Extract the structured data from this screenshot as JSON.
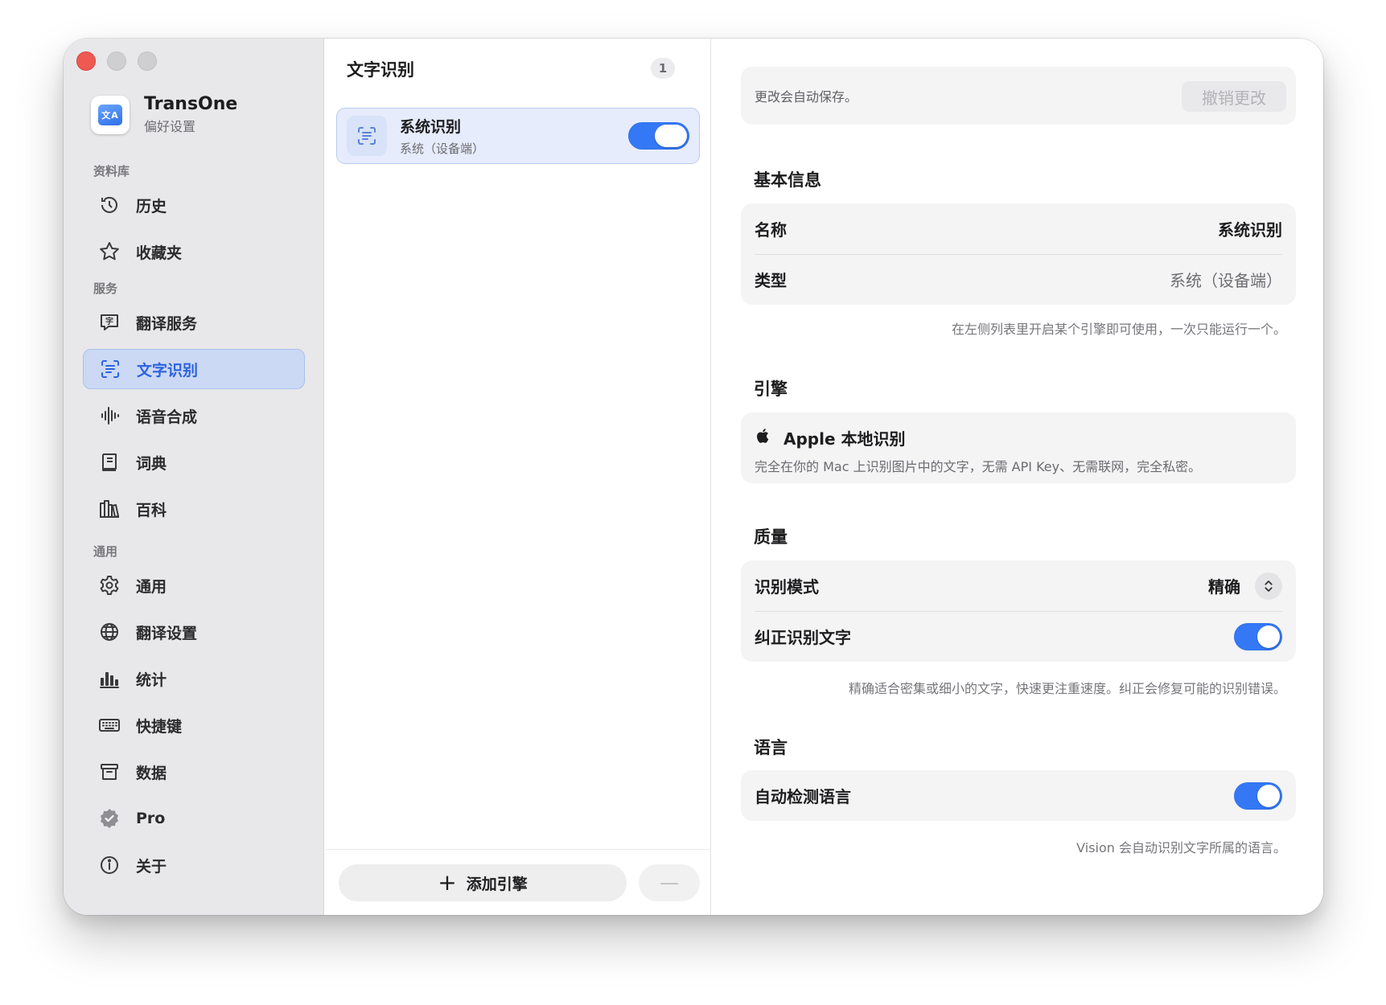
{
  "app": {
    "name": "TransOne",
    "subtitle": "偏好设置",
    "icon": "translate-app-icon"
  },
  "sidebar": {
    "sections": [
      {
        "label": "资料库"
      },
      {
        "label": "服务"
      },
      {
        "label": "通用"
      }
    ],
    "items": [
      {
        "label": "历史",
        "icon": "clock-icon"
      },
      {
        "label": "收藏夹",
        "icon": "star-icon"
      },
      {
        "label": "翻译服务",
        "icon": "translate-bubble-icon"
      },
      {
        "label": "文字识别",
        "icon": "text-scan-icon",
        "active": true
      },
      {
        "label": "语音合成",
        "icon": "waveform-icon"
      },
      {
        "label": "词典",
        "icon": "book-icon"
      },
      {
        "label": "百科",
        "icon": "books-icon"
      },
      {
        "label": "通用",
        "icon": "gear-icon"
      },
      {
        "label": "翻译设置",
        "icon": "globe-icon"
      },
      {
        "label": "统计",
        "icon": "bar-chart-icon"
      },
      {
        "label": "快捷键",
        "icon": "keyboard-icon"
      },
      {
        "label": "数据",
        "icon": "archive-box-icon"
      },
      {
        "label": "Pro",
        "icon": "verified-badge-icon"
      },
      {
        "label": "关于",
        "icon": "info-icon"
      }
    ]
  },
  "list": {
    "title": "文字识别",
    "count": "1",
    "engines": [
      {
        "name": "系统识别",
        "subtitle": "系统（设备端）",
        "enabled": true
      }
    ],
    "add_label": "添加引擎",
    "remove_label": "—"
  },
  "detail": {
    "banner": {
      "text": "更改会自动保存。",
      "revert_label": "撤销更改"
    },
    "basic": {
      "title": "基本信息",
      "name_label": "名称",
      "name_value": "系统识别",
      "type_label": "类型",
      "type_value": "系统（设备端）",
      "note": "在左侧列表里开启某个引擎即可使用，一次只能运行一个。"
    },
    "engine": {
      "title": "引擎",
      "name": "Apple 本地识别",
      "desc": "完全在你的 Mac 上识别图片中的文字，无需 API Key、无需联网，完全私密。"
    },
    "quality": {
      "title": "质量",
      "mode_label": "识别模式",
      "mode_value": "精确",
      "correct_label": "纠正识别文字",
      "correct_enabled": true,
      "note": "精确适合密集或细小的文字，快速更注重速度。纠正会修复可能的识别错误。"
    },
    "language": {
      "title": "语言",
      "auto_label": "自动检测语言",
      "auto_enabled": true,
      "note": "Vision 会自动识别文字所属的语言。"
    }
  },
  "colors": {
    "accent": "#3478f6",
    "active_bg": "#ccd9f4",
    "active_text": "#2d63e0",
    "close": "#ee5a52"
  }
}
